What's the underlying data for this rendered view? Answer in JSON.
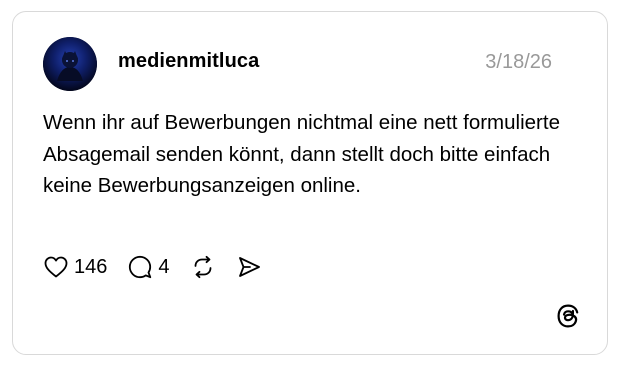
{
  "post": {
    "username": "medienmitluca",
    "date": "3/18/26",
    "text": "Wenn ihr auf Bewerbungen nichtmal eine nett formulierte Absagemail senden könnt, dann stellt doch bitte einfach keine Bewerbungsanzeigen online."
  },
  "actions": {
    "likes": "146",
    "replies": "4",
    "like_icon": "heart-icon",
    "reply_icon": "comment-bubble-icon",
    "repost_icon": "repost-icon",
    "share_icon": "send-icon"
  },
  "branding": {
    "logo_icon": "threads-logo-icon"
  },
  "colors": {
    "date_gray": "#999999",
    "border": "#d9d9d9"
  }
}
